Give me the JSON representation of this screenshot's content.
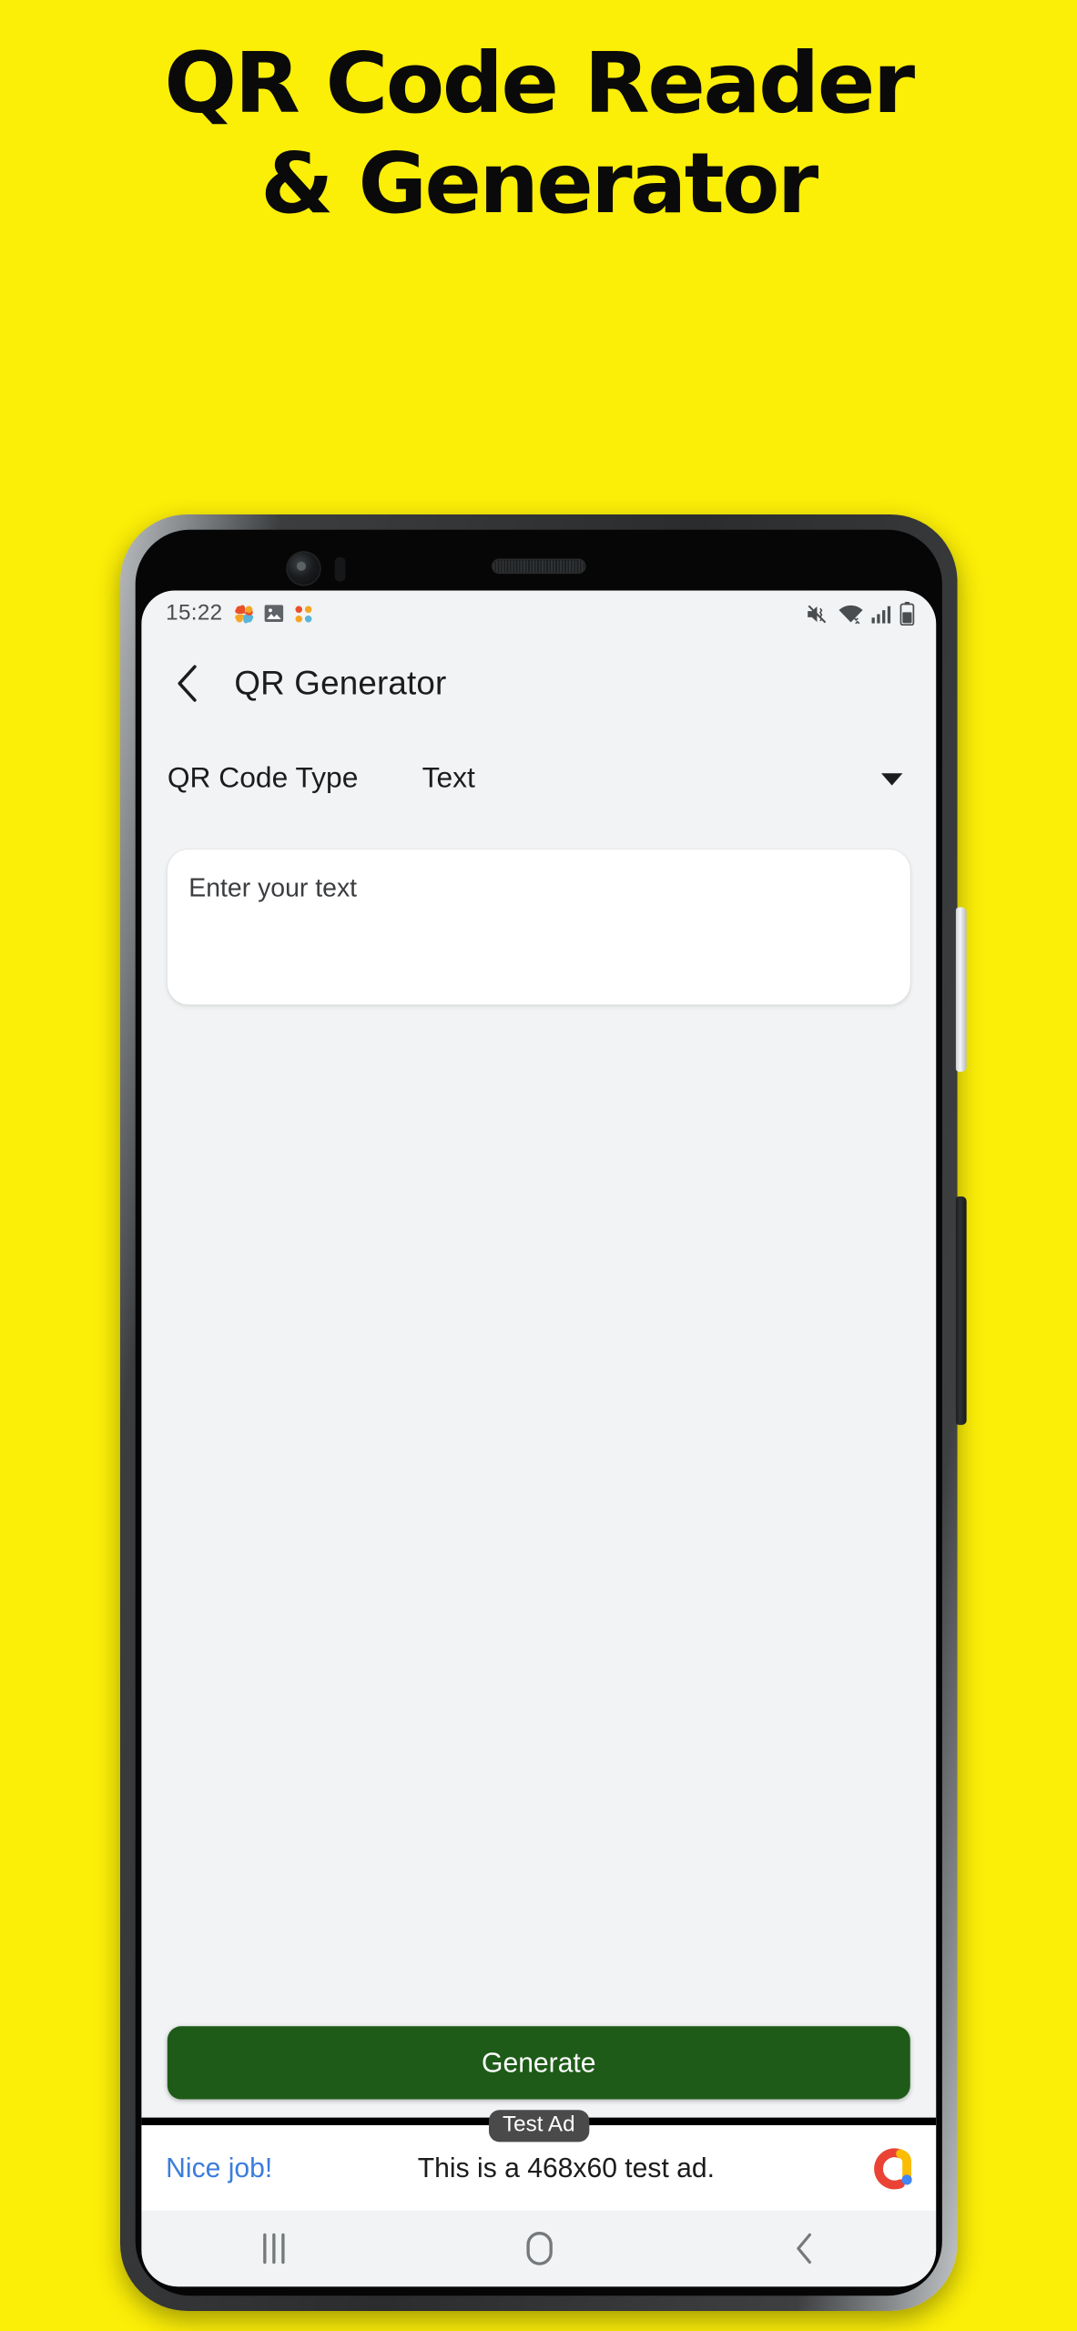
{
  "promo": {
    "background_color": "#FBEE07",
    "title_line_1": "QR Code Reader",
    "title_line_2": "& Generator",
    "title_color": "#0a0a0a"
  },
  "phone": {
    "hardware": {
      "front_camera": "front-camera-icon",
      "earpiece": "earpiece-speaker",
      "volume_button": "volume-button",
      "power_button": "power-button"
    }
  },
  "status_bar": {
    "time": "15:22",
    "left_icons": [
      "pinwheel-icon",
      "gallery-image-icon",
      "pinwheel-icon"
    ],
    "right_icons": [
      "mute-vibrate-icon",
      "wifi-icon",
      "cellular-signal-icon",
      "battery-icon"
    ]
  },
  "app_bar": {
    "back_icon": "back-chevron-icon",
    "title": "QR Generator"
  },
  "qr_type_row": {
    "label": "QR Code Type",
    "selected_value": "Text",
    "caret_icon": "chevron-down-icon"
  },
  "text_input": {
    "placeholder": "Enter your text",
    "value": ""
  },
  "generate": {
    "label": "Generate",
    "color": "#1e5b18",
    "text_color": "#ffffff"
  },
  "ad": {
    "badge": "Test Ad",
    "cta": "Nice job!",
    "cta_color": "#3b7ddd",
    "body": "This is a 468x60 test ad.",
    "logo": "admob-logo"
  },
  "nav_bar": {
    "recents_label": "recents-button",
    "home_label": "home-button",
    "back_label": "back-button"
  }
}
